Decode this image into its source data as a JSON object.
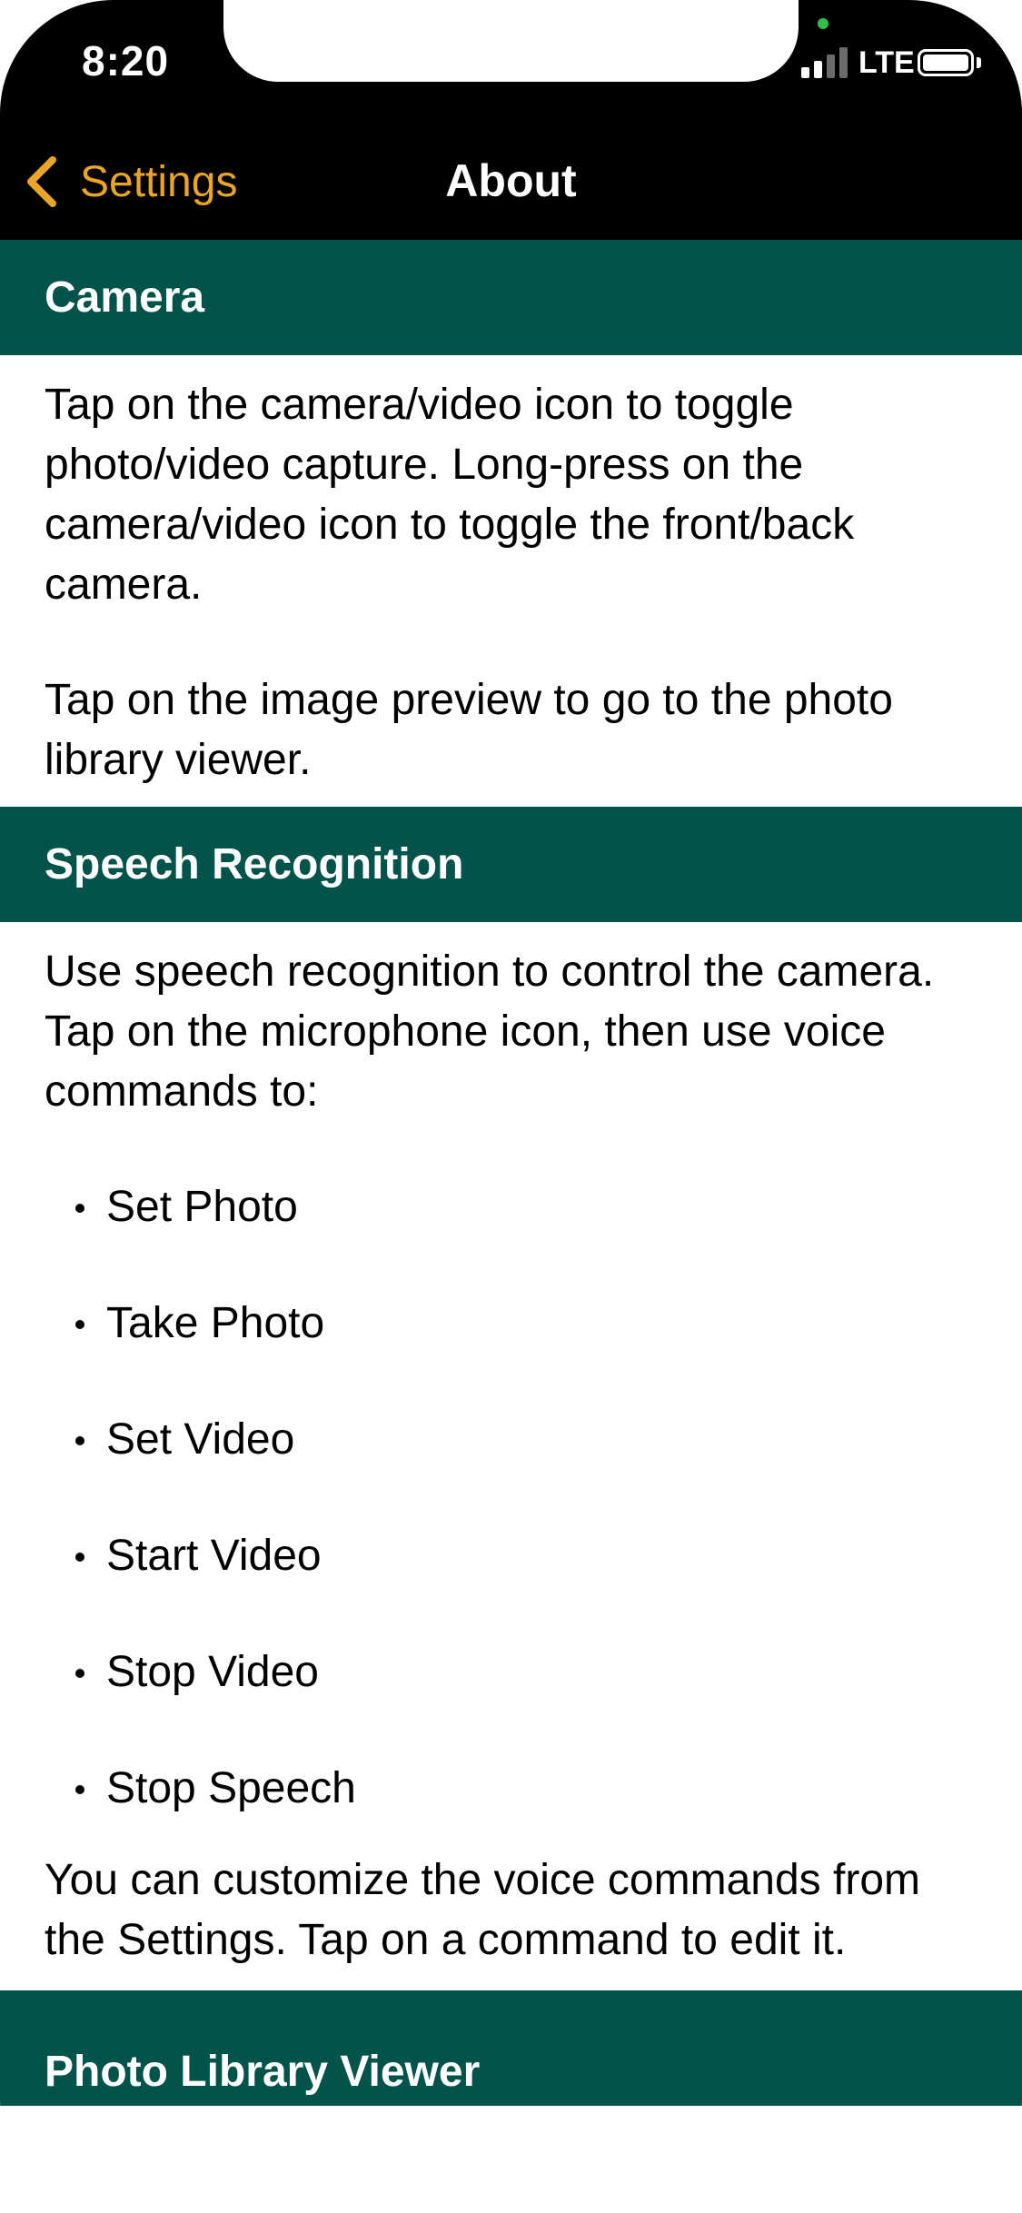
{
  "status_bar": {
    "time": "8:20",
    "network": "LTE"
  },
  "nav": {
    "back_label": "Settings",
    "title": "About"
  },
  "colors": {
    "accent": "#e8a526",
    "section_header_bg": "#02534a",
    "nav_bg": "#000000"
  },
  "sections": [
    {
      "title": "Camera",
      "paragraphs": [
        "Tap on the camera/video icon to toggle photo/video capture. Long-press on the camera/video icon to toggle the front/back camera.",
        "Tap on the image preview to go to the photo library viewer."
      ]
    },
    {
      "title": "Speech Recognition",
      "intro": "Use speech recognition to control the camera. Tap on the microphone icon, then use voice commands to:",
      "commands": [
        "Set Photo",
        "Take Photo",
        "Set Video",
        "Start Video",
        "Stop Video",
        "Stop Speech"
      ],
      "outro": "You can customize the voice commands from the Settings. Tap on a command to edit it."
    },
    {
      "title": "Photo Library Viewer"
    }
  ]
}
